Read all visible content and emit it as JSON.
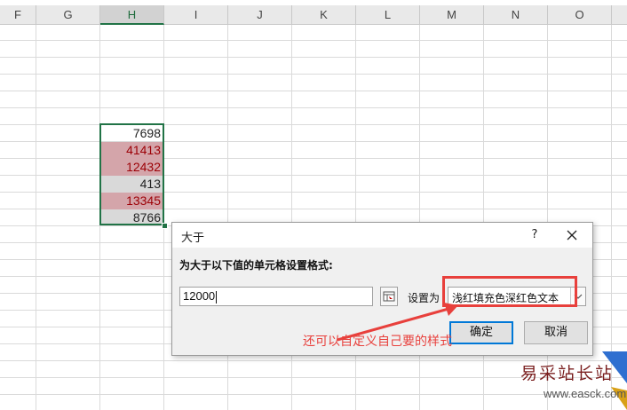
{
  "columns": [
    "F",
    "G",
    "H",
    "I",
    "J",
    "K",
    "L",
    "M",
    "N",
    "O"
  ],
  "selected_column": "H",
  "cells": [
    {
      "value": "7698",
      "style": "none"
    },
    {
      "value": "41413",
      "style": "red"
    },
    {
      "value": "12432",
      "style": "red"
    },
    {
      "value": "413",
      "style": "gray"
    },
    {
      "value": "13345",
      "style": "red"
    },
    {
      "value": "8766",
      "style": "gray"
    }
  ],
  "dialog": {
    "title": "大于",
    "help": "?",
    "prompt": "为大于以下值的单元格设置格式:",
    "value": "12000",
    "set_label": "设置为",
    "format_selected": "浅红填充色深红色文本",
    "ok_label": "确定",
    "cancel_label": "取消"
  },
  "annotation": "还可以自定义自己要的样式",
  "watermark": {
    "text": "易采站长站",
    "url": "www.easck.com"
  },
  "colors": {
    "highlight_red_fill": "#d4a5aa",
    "highlight_red_text": "#9c0006",
    "highlight_gray": "#d9d9d9",
    "selection_green": "#217346",
    "annotation_red": "#e8403c",
    "ok_border": "#0078d7"
  }
}
